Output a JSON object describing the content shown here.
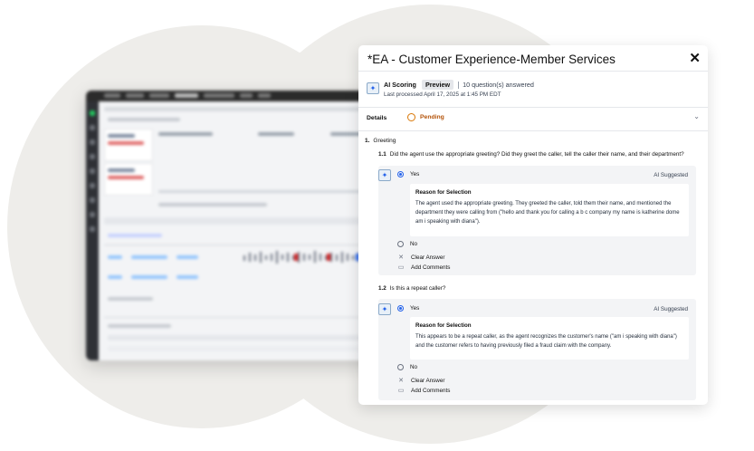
{
  "panel": {
    "title": "*EA - Customer Experience-Member Services",
    "close_icon": "close-icon"
  },
  "scoring": {
    "label": "AI Scoring",
    "badge": "Preview",
    "answered": "10 question(s) answered",
    "last_processed": "Last processed April 17, 2025 at 1:45 PM EDT"
  },
  "details": {
    "label": "Details",
    "status": "Pending"
  },
  "section": {
    "number": "1.",
    "title": "Greeting"
  },
  "questions": [
    {
      "number": "1.1",
      "text": "Did the agent use the appropriate greeting? Did they greet the caller, tell the caller their name, and their department?",
      "selected": "Yes",
      "ai_suggested": "AI Suggested",
      "reason_title": "Reason for Selection",
      "reason_text": "The agent used the appropriate greeting. They greeted the caller, told them their name, and mentioned the department they were calling from (\"hello and thank you for calling a b c company my name is katherine dome am i speaking with diana\").",
      "other_option": "No",
      "clear": "Clear Answer",
      "comments": "Add Comments"
    },
    {
      "number": "1.2",
      "text": "Is this a repeat caller?",
      "selected": "Yes",
      "ai_suggested": "AI Suggested",
      "reason_title": "Reason for Selection",
      "reason_text": "This appears to be a repeat caller, as the agent recognizes the customer's name (\"am i speaking with diana\") and the customer refers to having previously filed a fraud claim with the company.",
      "other_option": "No",
      "clear": "Clear Answer",
      "comments": "Add Comments"
    }
  ]
}
